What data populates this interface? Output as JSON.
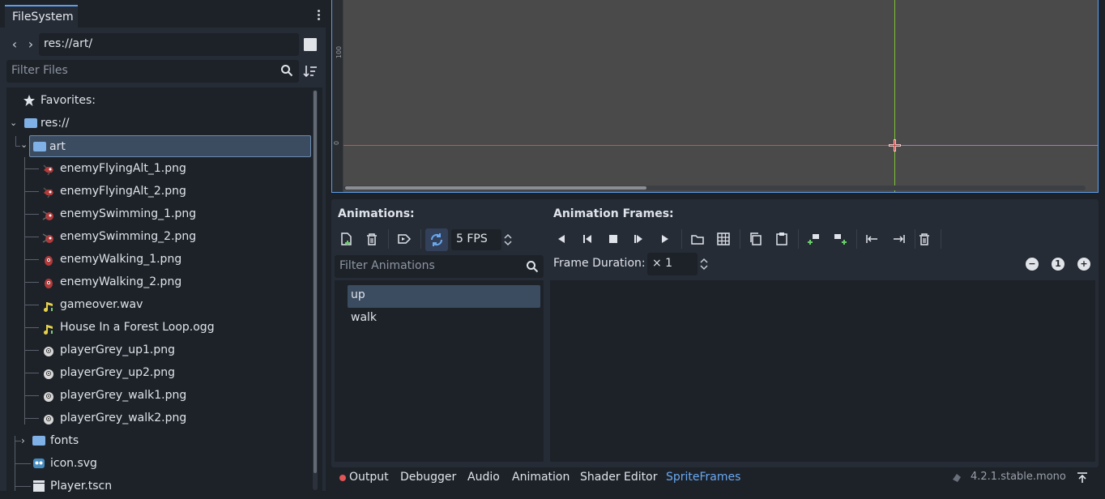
{
  "filesystem": {
    "tab_label": "FileSystem",
    "path": "res://art/",
    "filter_placeholder": "Filter Files",
    "tree": {
      "favorites": "Favorites:",
      "root": "res://",
      "art_folder": "art",
      "files": [
        {
          "name": "enemyFlyingAlt_1.png",
          "icon": "enemy-fly-icon"
        },
        {
          "name": "enemyFlyingAlt_2.png",
          "icon": "enemy-fly-icon"
        },
        {
          "name": "enemySwimming_1.png",
          "icon": "enemy-swim-icon"
        },
        {
          "name": "enemySwimming_2.png",
          "icon": "enemy-swim-icon"
        },
        {
          "name": "enemyWalking_1.png",
          "icon": "enemy-walk-icon"
        },
        {
          "name": "enemyWalking_2.png",
          "icon": "enemy-walk-icon"
        },
        {
          "name": "gameover.wav",
          "icon": "audio-icon"
        },
        {
          "name": "House In a Forest Loop.ogg",
          "icon": "audio-icon"
        },
        {
          "name": "playerGrey_up1.png",
          "icon": "player-icon"
        },
        {
          "name": "playerGrey_up2.png",
          "icon": "player-icon"
        },
        {
          "name": "playerGrey_walk1.png",
          "icon": "player-icon"
        },
        {
          "name": "playerGrey_walk2.png",
          "icon": "player-icon"
        }
      ],
      "fonts_folder": "fonts",
      "icon_file": "icon.svg",
      "player_scene": "Player.tscn"
    }
  },
  "viewport": {
    "ruler_label_100": "100",
    "ruler_label_0": "0"
  },
  "spriteframes": {
    "animations_title": "Animations:",
    "frames_title": "Animation Frames:",
    "fps": "5 FPS",
    "filter_anim_placeholder": "Filter Animations",
    "animations": [
      "up",
      "walk"
    ],
    "frame_duration_label": "Frame Duration:",
    "frame_duration_value": "× 1",
    "zoom_reset": "1"
  },
  "bottom_tabs": {
    "output": "Output",
    "debugger": "Debugger",
    "audio": "Audio",
    "animation": "Animation",
    "shader_editor": "Shader Editor",
    "spriteframes": "SpriteFrames"
  },
  "version": "4.2.1.stable.mono",
  "colors": {
    "accent": "#5e9ee9",
    "active_tab": "#6aa8f0",
    "selection": "#3b4b60",
    "axis_x": "#e04848",
    "axis_y": "#7fc23a"
  }
}
